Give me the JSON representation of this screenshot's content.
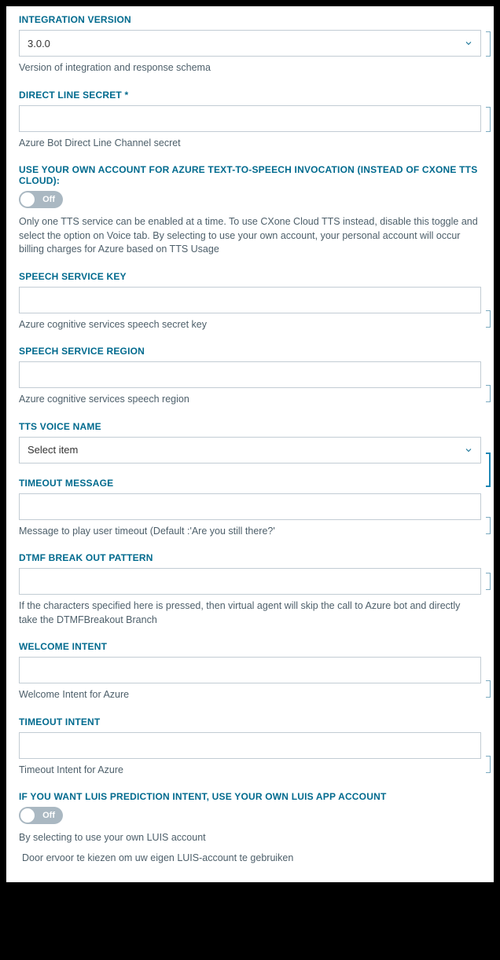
{
  "integration_version": {
    "label": "INTEGRATION VERSION",
    "value": "3.0.0",
    "helper": "Version of integration and response schema"
  },
  "direct_line_secret": {
    "label": "DIRECT LINE SECRET *",
    "value": "",
    "helper": "Azure Bot Direct Line Channel secret"
  },
  "own_tts_account": {
    "label": "USE YOUR OWN ACCOUNT FOR AZURE TEXT-TO-SPEECH INVOCATION (INSTEAD OF CXONE TTS CLOUD):",
    "toggle_label": "Off",
    "helper": "Only one TTS service can be enabled at a time. To use CXone Cloud TTS instead, disable this toggle and select the option on Voice tab. By selecting to use your own account, your personal account will occur billing charges for Azure based on TTS Usage"
  },
  "speech_service_key": {
    "label": "SPEECH SERVICE KEY",
    "value": "",
    "helper": "Azure cognitive services speech secret key"
  },
  "speech_service_region": {
    "label": "SPEECH SERVICE REGION",
    "value": "",
    "helper": "Azure cognitive services speech region"
  },
  "tts_voice_name": {
    "label": "TTS VOICE NAME",
    "value": "Select item"
  },
  "timeout_message": {
    "label": "TIMEOUT MESSAGE",
    "value": "",
    "helper": "Message to play user timeout (Default :'Are you still there?'"
  },
  "dtmf_breakout": {
    "label": "DTMF BREAK OUT PATTERN",
    "value": "",
    "helper": "If the characters specified here is pressed, then virtual agent will skip the call to Azure bot and directly take the DTMFBreakout Branch"
  },
  "welcome_intent": {
    "label": "WELCOME INTENT",
    "value": "",
    "helper": "Welcome Intent for Azure"
  },
  "timeout_intent": {
    "label": "TIMEOUT INTENT",
    "value": "",
    "helper": "Timeout Intent for Azure"
  },
  "luis_account": {
    "label": "IF YOU WANT LUIS PREDICTION INTENT, USE YOUR OWN LUIS APP ACCOUNT",
    "toggle_label": "Off",
    "helper": "By selecting to use your own LUIS account",
    "helper2": "Door ervoor te kiezen om uw eigen LUIS-account te gebruiken"
  }
}
